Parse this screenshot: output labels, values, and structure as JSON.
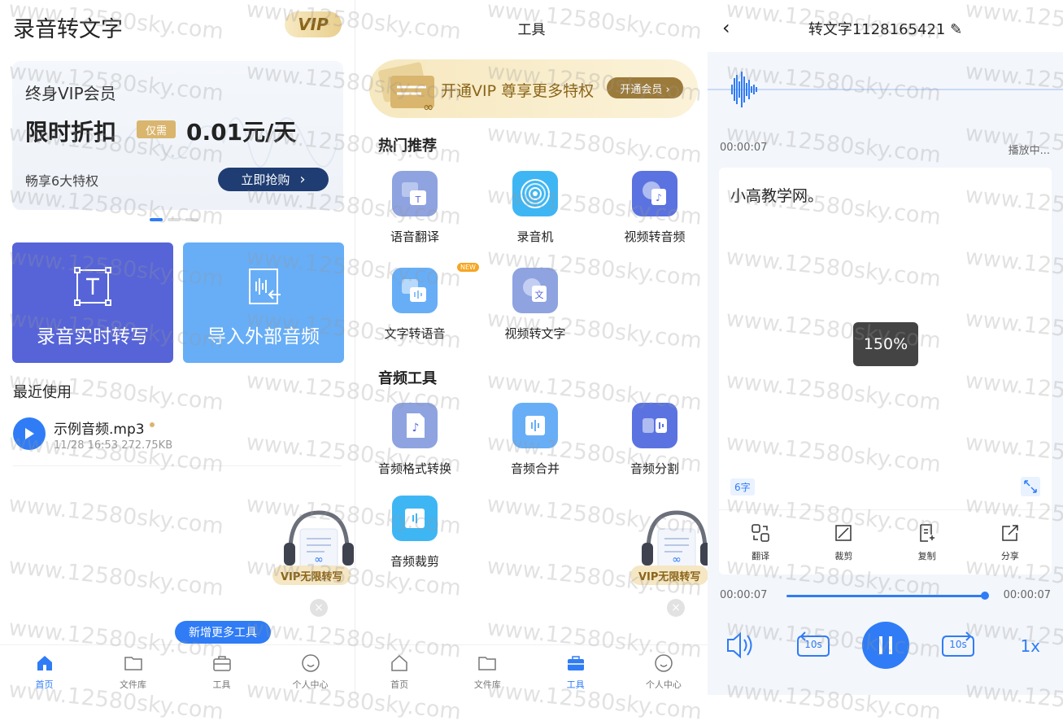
{
  "home": {
    "app_title": "录音转文字",
    "vip_badge": "VIP",
    "vip_card": {
      "title": "终身VIP会员",
      "promo": "限时折扣",
      "tag": "仅需",
      "price": "0.01元/天",
      "perks": "畅享6大特权",
      "buy_button": "立即抢购",
      "buy_arrow": "›"
    },
    "actions": {
      "record_realtime": "录音实时转写",
      "import_audio": "导入外部音频"
    },
    "recent": {
      "heading": "最近使用",
      "file_name": "示例音频.mp3",
      "file_meta": "11/28 16:53   272.75KB"
    },
    "vip_unlimited": "VIP无限转写",
    "close_icon": "×",
    "tooltip": "新增更多工具",
    "tabs": [
      "首页",
      "文件库",
      "工具",
      "个人中心"
    ]
  },
  "tools": {
    "title": "工具",
    "banner": {
      "text": "开通VIP 尊享更多特权",
      "button": "开通会员 ›"
    },
    "hot_heading": "热门推荐",
    "hot_tools": [
      "语音翻译",
      "录音机",
      "视频转音频",
      "文字转语音",
      "视频转文字"
    ],
    "new_badge": "NEW",
    "audio_heading": "音频工具",
    "audio_tools": [
      "音频格式转换",
      "音频合并",
      "音频分割",
      "音频裁剪"
    ],
    "vip_unlimited": "VIP无限转写",
    "close_icon": "×",
    "tabs": [
      "首页",
      "文件库",
      "工具",
      "个人中心"
    ]
  },
  "player": {
    "back_icon": "‹",
    "title": "转文字1128165421 ✎",
    "current_time": "00:00:07",
    "status": "播放中...",
    "transcript": "小高教学网。",
    "speed_overlay": "150%",
    "char_count": "6字",
    "actions": [
      "翻译",
      "裁剪",
      "复制",
      "分享"
    ],
    "progress_start": "00:00:07",
    "progress_end": "00:00:07",
    "progress_fraction": 0.99,
    "rewind_label": "10s",
    "forward_label": "10s",
    "rate": "1x"
  },
  "watermark": "www.12580sky.com",
  "colors": {
    "accent": "#2f7cf6",
    "gold": "#d9b56d",
    "indigo": "#5664d8",
    "sky": "#67aef7"
  }
}
